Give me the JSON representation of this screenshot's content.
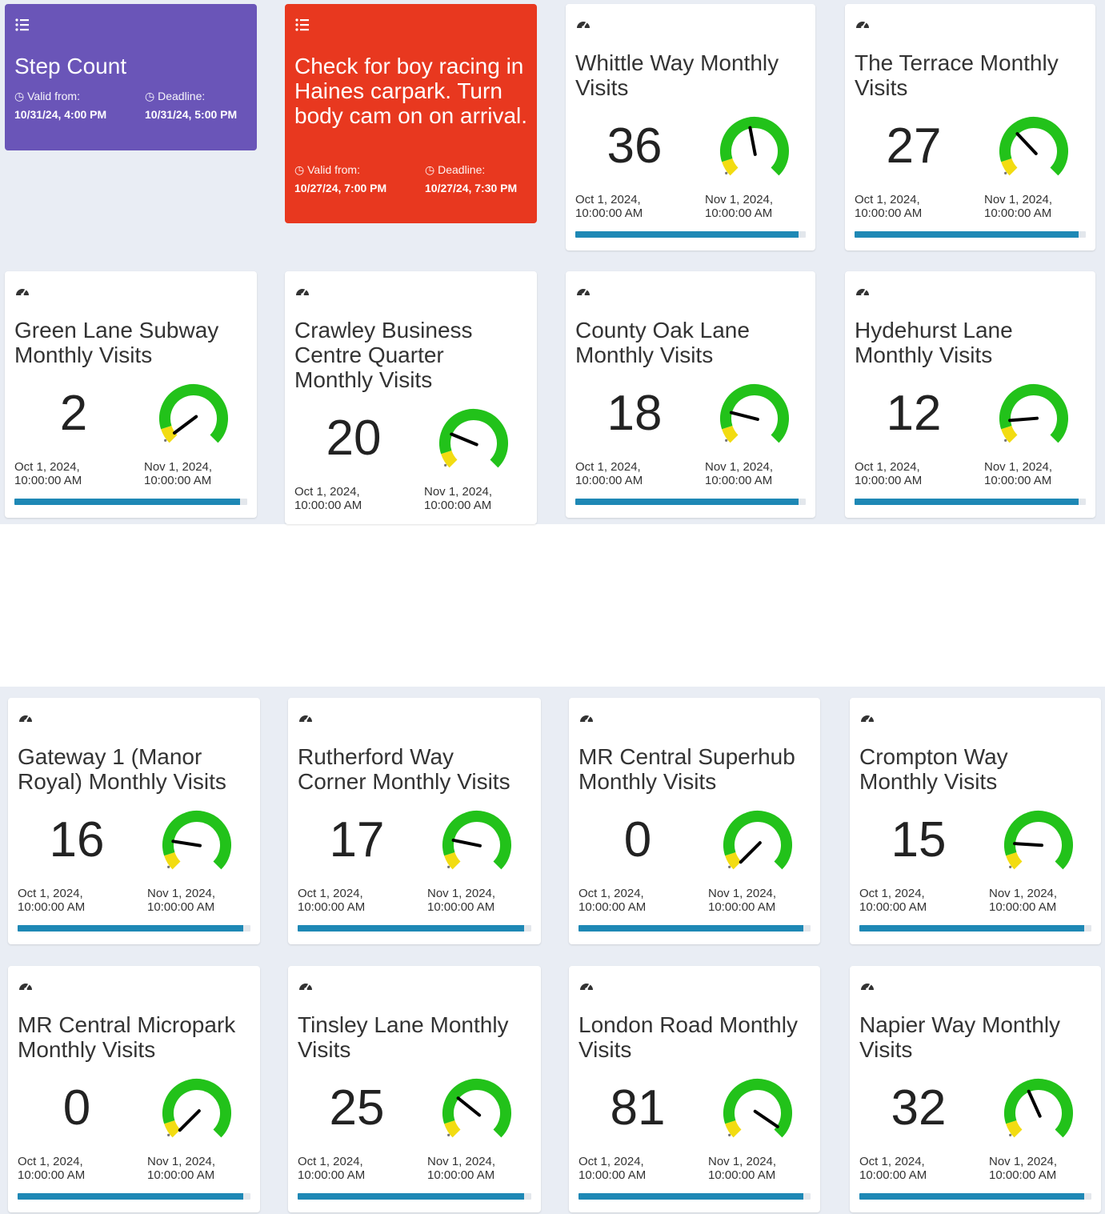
{
  "tasks": [
    {
      "title": "Step Count",
      "color": "#6a55b8",
      "valid_label": "Valid from:",
      "valid_value": "10/31/24, 4:00 PM",
      "deadline_label": "Deadline:",
      "deadline_value": "10/31/24, 5:00 PM",
      "icon": "list-icon"
    },
    {
      "title": "Check for boy racing in Haines carpark. Turn body cam on on arrival.",
      "color": "#e8381f",
      "valid_label": "Valid from:",
      "valid_value": "10/27/24, 7:00 PM",
      "deadline_label": "Deadline:",
      "deadline_value": "10/27/24, 7:30 PM",
      "icon": "list-icon"
    }
  ],
  "gauge_colors": {
    "good": "#22c21a",
    "warn": "#f2dc12",
    "needle": "#000000"
  },
  "cards": [
    {
      "title": "Whittle Way Monthly Visits",
      "value": "36",
      "needle": 0.46,
      "start": "Oct 1, 2024, 10:00:00 AM",
      "end": "Nov 1, 2024, 10:00:00 AM",
      "progress": 0.97,
      "icon": "gauge-icon"
    },
    {
      "title": "The Terrace Monthly Visits",
      "value": "27",
      "needle": 0.34,
      "start": "Oct 1, 2024, 10:00:00 AM",
      "end": "Nov 1, 2024, 10:00:00 AM",
      "progress": 0.97,
      "icon": "gauge-icon"
    },
    {
      "title": "Green Lane Subway Monthly Visits",
      "value": "2",
      "needle": 0.03,
      "start": "Oct 1, 2024, 10:00:00 AM",
      "end": "Nov 1, 2024, 10:00:00 AM",
      "progress": 0.97,
      "icon": "gauge-icon"
    },
    {
      "title": "Crawley Business Centre Quarter Monthly Visits",
      "value": "20",
      "needle": 0.25,
      "start": "Oct 1, 2024, 10:00:00 AM",
      "end": "Nov 1, 2024, 10:00:00 AM",
      "progress": 0.97,
      "icon": "gauge-icon"
    },
    {
      "title": "County Oak Lane Monthly Visits",
      "value": "18",
      "needle": 0.22,
      "start": "Oct 1, 2024, 10:00:00 AM",
      "end": "Nov 1, 2024, 10:00:00 AM",
      "progress": 0.97,
      "icon": "gauge-icon"
    },
    {
      "title": "Hydehurst Lane Monthly Visits",
      "value": "12",
      "needle": 0.15,
      "start": "Oct 1, 2024, 10:00:00 AM",
      "end": "Nov 1, 2024, 10:00:00 AM",
      "progress": 0.97,
      "icon": "gauge-icon"
    },
    {
      "title": "Gateway 1 (Manor Royal) Monthly Visits",
      "value": "16",
      "needle": 0.2,
      "start": "Oct 1, 2024, 10:00:00 AM",
      "end": "Nov 1, 2024, 10:00:00 AM",
      "progress": 0.97,
      "icon": "gauge-icon"
    },
    {
      "title": "Rutherford Way Corner Monthly Visits",
      "value": "17",
      "needle": 0.21,
      "start": "Oct 1, 2024, 10:00:00 AM",
      "end": "Nov 1, 2024, 10:00:00 AM",
      "progress": 0.97,
      "icon": "gauge-icon"
    },
    {
      "title": "MR Central Superhub Monthly Visits",
      "value": "0",
      "needle": 0.0,
      "start": "Oct 1, 2024, 10:00:00 AM",
      "end": "Nov 1, 2024, 10:00:00 AM",
      "progress": 0.97,
      "icon": "gauge-icon"
    },
    {
      "title": "Crompton Way Monthly Visits",
      "value": "15",
      "needle": 0.18,
      "start": "Oct 1, 2024, 10:00:00 AM",
      "end": "Nov 1, 2024, 10:00:00 AM",
      "progress": 0.97,
      "icon": "gauge-icon"
    },
    {
      "title": "MR Central Micropark Monthly Visits",
      "value": "0",
      "needle": 0.0,
      "start": "Oct 1, 2024, 10:00:00 AM",
      "end": "Nov 1, 2024, 10:00:00 AM",
      "progress": 0.97,
      "icon": "gauge-icon"
    },
    {
      "title": "Tinsley Lane Monthly Visits",
      "value": "25",
      "needle": 0.31,
      "start": "Oct 1, 2024, 10:00:00 AM",
      "end": "Nov 1, 2024, 10:00:00 AM",
      "progress": 0.97,
      "icon": "gauge-icon"
    },
    {
      "title": "London Road Monthly Visits",
      "value": "81",
      "needle": 0.96,
      "start": "Oct 1, 2024, 10:00:00 AM",
      "end": "Nov 1, 2024, 10:00:00 AM",
      "progress": 0.97,
      "icon": "gauge-icon"
    },
    {
      "title": "Napier Way Monthly Visits",
      "value": "32",
      "needle": 0.41,
      "start": "Oct 1, 2024, 10:00:00 AM",
      "end": "Nov 1, 2024, 10:00:00 AM",
      "progress": 0.97,
      "icon": "gauge-icon"
    }
  ]
}
